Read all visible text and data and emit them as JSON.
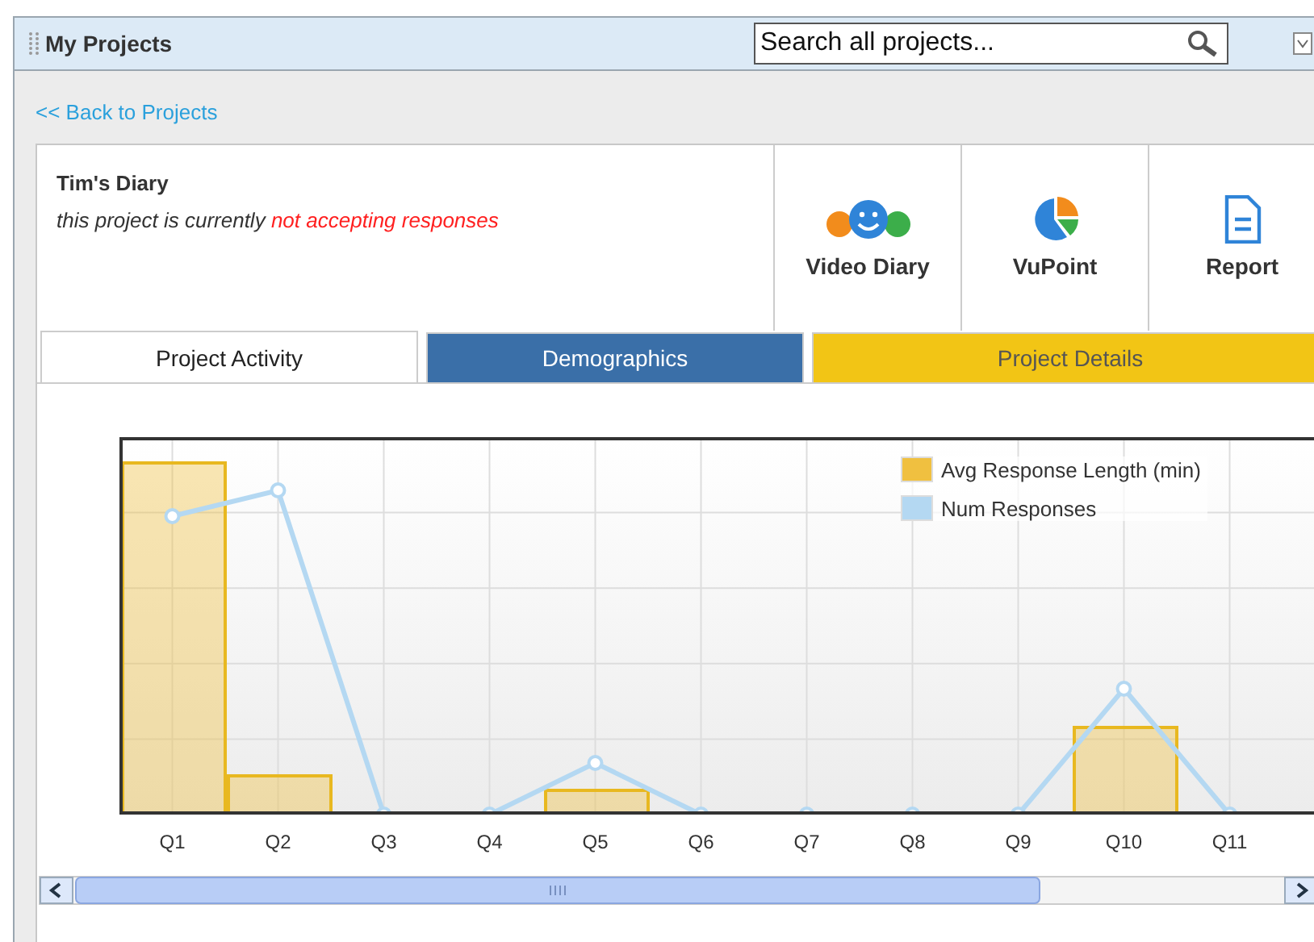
{
  "panel": {
    "title": "My Projects"
  },
  "search": {
    "placeholder": "Search all projects..."
  },
  "back_link": "<< Back to Projects",
  "project": {
    "name": "Tim's Diary",
    "status_text": "this project is currently",
    "status_highlight": "not accepting responses"
  },
  "tools": [
    {
      "kind": "faces",
      "label": "Video Diary"
    },
    {
      "kind": "pie",
      "label": "VuPoint"
    },
    {
      "kind": "document",
      "label": "Report"
    }
  ],
  "tabs": [
    {
      "label": "Project Activity",
      "selected": true,
      "color": "#ffffff"
    },
    {
      "label": "Demographics",
      "selected": false,
      "color": "#3a6fa8"
    },
    {
      "label": "Project Details",
      "selected": false,
      "color": "#f2c515"
    }
  ],
  "chart": {
    "legend": [
      {
        "label": "Avg Response Length (min)",
        "color": "#f0c040"
      },
      {
        "label": "Num Responses",
        "color": "#b4d8f2"
      }
    ],
    "x_labels": [
      "Q1",
      "Q2",
      "Q3",
      "Q4",
      "Q5",
      "Q6",
      "Q7",
      "Q8",
      "Q9",
      "Q10",
      "Q11"
    ]
  }
}
